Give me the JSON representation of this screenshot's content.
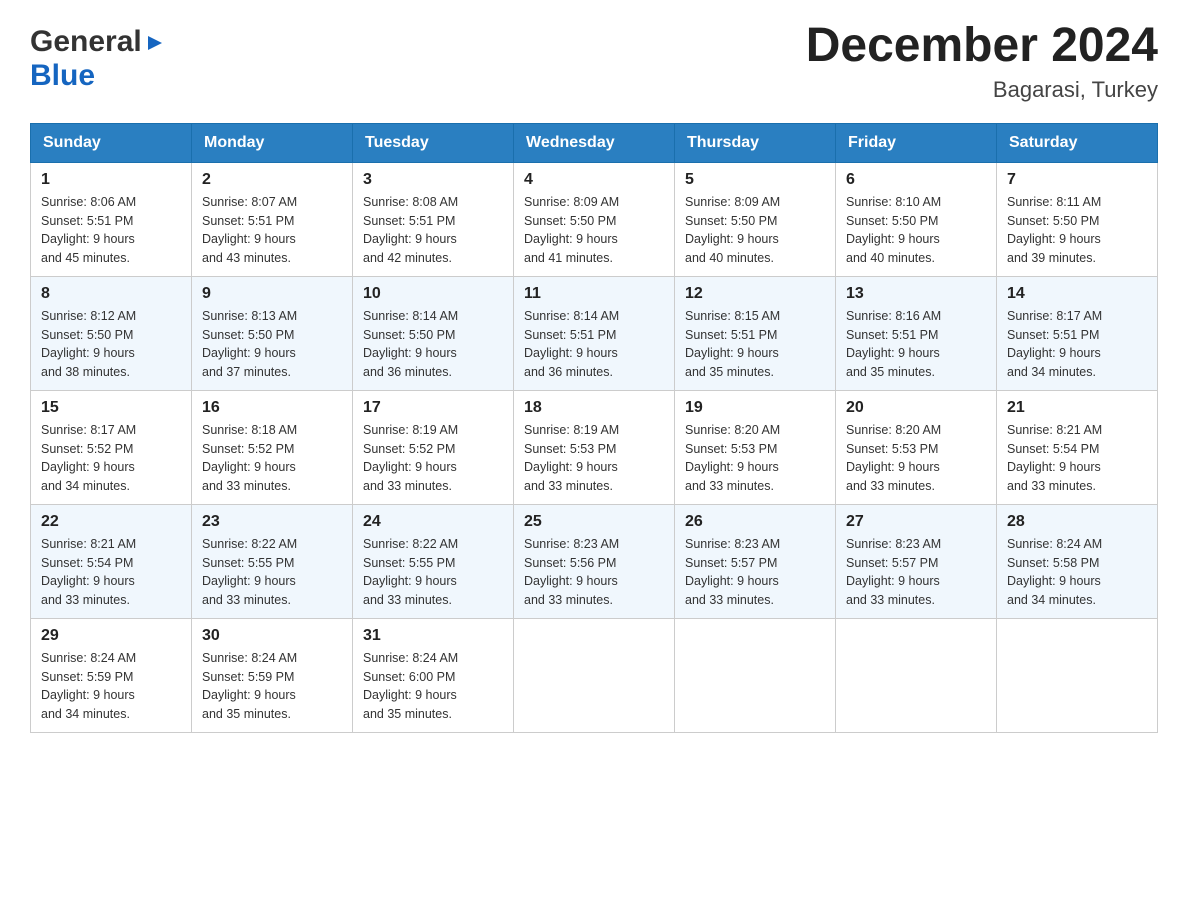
{
  "logo": {
    "general": "General",
    "blue": "Blue",
    "arrow": "▶"
  },
  "title": "December 2024",
  "subtitle": "Bagarasi, Turkey",
  "days": [
    "Sunday",
    "Monday",
    "Tuesday",
    "Wednesday",
    "Thursday",
    "Friday",
    "Saturday"
  ],
  "weeks": [
    [
      {
        "num": "1",
        "sunrise": "8:06 AM",
        "sunset": "5:51 PM",
        "daylight": "9 hours and 45 minutes."
      },
      {
        "num": "2",
        "sunrise": "8:07 AM",
        "sunset": "5:51 PM",
        "daylight": "9 hours and 43 minutes."
      },
      {
        "num": "3",
        "sunrise": "8:08 AM",
        "sunset": "5:51 PM",
        "daylight": "9 hours and 42 minutes."
      },
      {
        "num": "4",
        "sunrise": "8:09 AM",
        "sunset": "5:50 PM",
        "daylight": "9 hours and 41 minutes."
      },
      {
        "num": "5",
        "sunrise": "8:09 AM",
        "sunset": "5:50 PM",
        "daylight": "9 hours and 40 minutes."
      },
      {
        "num": "6",
        "sunrise": "8:10 AM",
        "sunset": "5:50 PM",
        "daylight": "9 hours and 40 minutes."
      },
      {
        "num": "7",
        "sunrise": "8:11 AM",
        "sunset": "5:50 PM",
        "daylight": "9 hours and 39 minutes."
      }
    ],
    [
      {
        "num": "8",
        "sunrise": "8:12 AM",
        "sunset": "5:50 PM",
        "daylight": "9 hours and 38 minutes."
      },
      {
        "num": "9",
        "sunrise": "8:13 AM",
        "sunset": "5:50 PM",
        "daylight": "9 hours and 37 minutes."
      },
      {
        "num": "10",
        "sunrise": "8:14 AM",
        "sunset": "5:50 PM",
        "daylight": "9 hours and 36 minutes."
      },
      {
        "num": "11",
        "sunrise": "8:14 AM",
        "sunset": "5:51 PM",
        "daylight": "9 hours and 36 minutes."
      },
      {
        "num": "12",
        "sunrise": "8:15 AM",
        "sunset": "5:51 PM",
        "daylight": "9 hours and 35 minutes."
      },
      {
        "num": "13",
        "sunrise": "8:16 AM",
        "sunset": "5:51 PM",
        "daylight": "9 hours and 35 minutes."
      },
      {
        "num": "14",
        "sunrise": "8:17 AM",
        "sunset": "5:51 PM",
        "daylight": "9 hours and 34 minutes."
      }
    ],
    [
      {
        "num": "15",
        "sunrise": "8:17 AM",
        "sunset": "5:52 PM",
        "daylight": "9 hours and 34 minutes."
      },
      {
        "num": "16",
        "sunrise": "8:18 AM",
        "sunset": "5:52 PM",
        "daylight": "9 hours and 33 minutes."
      },
      {
        "num": "17",
        "sunrise": "8:19 AM",
        "sunset": "5:52 PM",
        "daylight": "9 hours and 33 minutes."
      },
      {
        "num": "18",
        "sunrise": "8:19 AM",
        "sunset": "5:53 PM",
        "daylight": "9 hours and 33 minutes."
      },
      {
        "num": "19",
        "sunrise": "8:20 AM",
        "sunset": "5:53 PM",
        "daylight": "9 hours and 33 minutes."
      },
      {
        "num": "20",
        "sunrise": "8:20 AM",
        "sunset": "5:53 PM",
        "daylight": "9 hours and 33 minutes."
      },
      {
        "num": "21",
        "sunrise": "8:21 AM",
        "sunset": "5:54 PM",
        "daylight": "9 hours and 33 minutes."
      }
    ],
    [
      {
        "num": "22",
        "sunrise": "8:21 AM",
        "sunset": "5:54 PM",
        "daylight": "9 hours and 33 minutes."
      },
      {
        "num": "23",
        "sunrise": "8:22 AM",
        "sunset": "5:55 PM",
        "daylight": "9 hours and 33 minutes."
      },
      {
        "num": "24",
        "sunrise": "8:22 AM",
        "sunset": "5:55 PM",
        "daylight": "9 hours and 33 minutes."
      },
      {
        "num": "25",
        "sunrise": "8:23 AM",
        "sunset": "5:56 PM",
        "daylight": "9 hours and 33 minutes."
      },
      {
        "num": "26",
        "sunrise": "8:23 AM",
        "sunset": "5:57 PM",
        "daylight": "9 hours and 33 minutes."
      },
      {
        "num": "27",
        "sunrise": "8:23 AM",
        "sunset": "5:57 PM",
        "daylight": "9 hours and 33 minutes."
      },
      {
        "num": "28",
        "sunrise": "8:24 AM",
        "sunset": "5:58 PM",
        "daylight": "9 hours and 34 minutes."
      }
    ],
    [
      {
        "num": "29",
        "sunrise": "8:24 AM",
        "sunset": "5:59 PM",
        "daylight": "9 hours and 34 minutes."
      },
      {
        "num": "30",
        "sunrise": "8:24 AM",
        "sunset": "5:59 PM",
        "daylight": "9 hours and 35 minutes."
      },
      {
        "num": "31",
        "sunrise": "8:24 AM",
        "sunset": "6:00 PM",
        "daylight": "9 hours and 35 minutes."
      },
      null,
      null,
      null,
      null
    ]
  ],
  "labels": {
    "sunrise": "Sunrise:",
    "sunset": "Sunset:",
    "daylight": "Daylight:"
  }
}
